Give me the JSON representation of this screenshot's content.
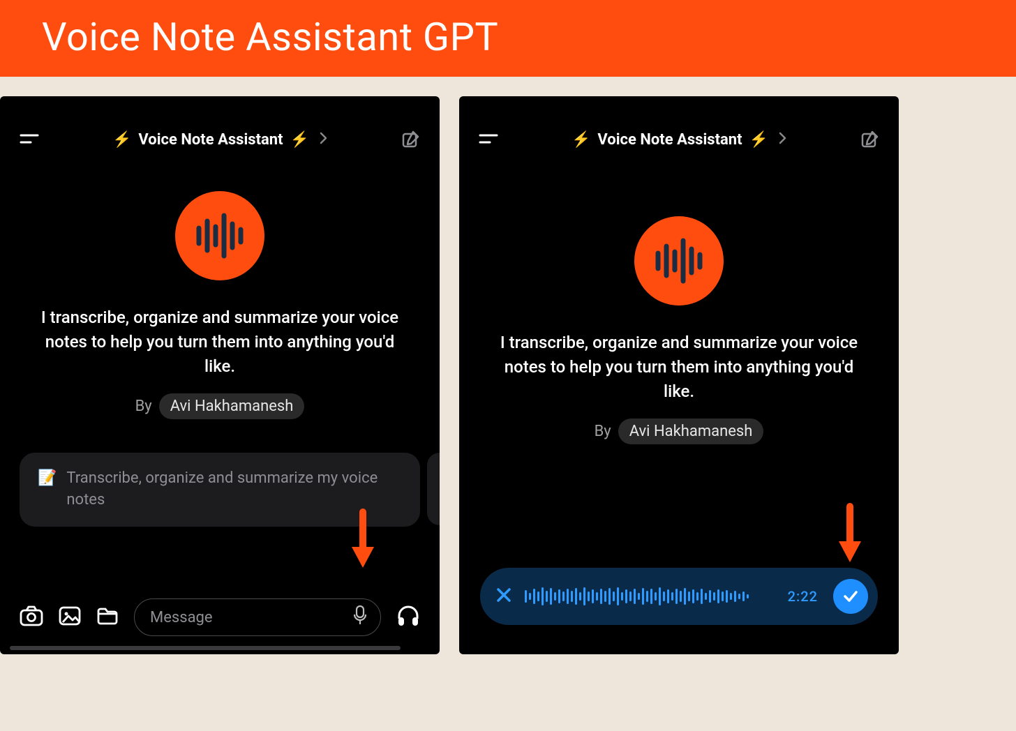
{
  "banner": {
    "title": "Voice Note Assistant GPT"
  },
  "gpt": {
    "title_prefix": "⚡",
    "title_text": "Voice Note Assistant",
    "title_suffix": "⚡",
    "description": "I transcribe, organize and summarize your voice notes to help you turn them into anything you'd like.",
    "by_label": "By",
    "author": "Avi Hakhamanesh"
  },
  "left": {
    "suggestion_icon": "📝",
    "suggestion_text": "Transcribe, organize and summarize my voice notes",
    "input_placeholder": "Message"
  },
  "right": {
    "recording_time": "2:22"
  },
  "icons": {
    "menu": "menu-icon",
    "compose": "compose-icon",
    "camera": "camera-icon",
    "image": "image-icon",
    "folder": "folder-icon",
    "mic": "mic-icon",
    "headphones": "headphones-icon",
    "close": "close-icon",
    "check": "check-icon",
    "chevron": "chevron-right-icon"
  }
}
